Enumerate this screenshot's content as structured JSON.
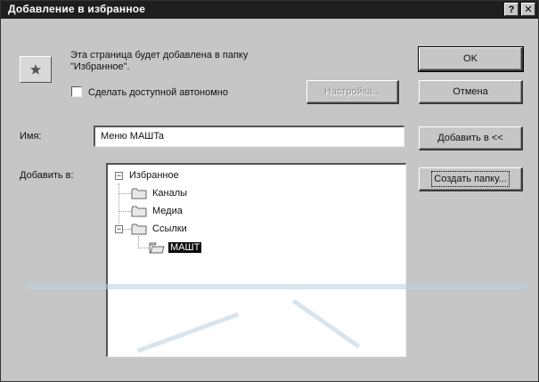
{
  "window": {
    "title": "Добавление в избранное",
    "help_glyph": "?",
    "close_glyph": "✕"
  },
  "info": {
    "line1": "Эта страница будет добавлена в папку",
    "line2": "\"Избранное\"."
  },
  "offline": {
    "label": "Сделать доступной автономно",
    "checked": false
  },
  "buttons": {
    "ok": "OK",
    "cancel": "Отмена",
    "settings": "Настройка...",
    "add_to": "Добавить в <<",
    "new_folder": "Создать папку..."
  },
  "name_field": {
    "label": "Имя:",
    "value": "Меню MAШTa"
  },
  "tree": {
    "label": "Добавить в:",
    "root": "Избранное",
    "items": [
      "Каналы",
      "Медиа",
      "Ссылки"
    ],
    "selected_child": "MAШT"
  },
  "icons": {
    "favorites": "favorites-icon",
    "folder": "folder-icon"
  }
}
